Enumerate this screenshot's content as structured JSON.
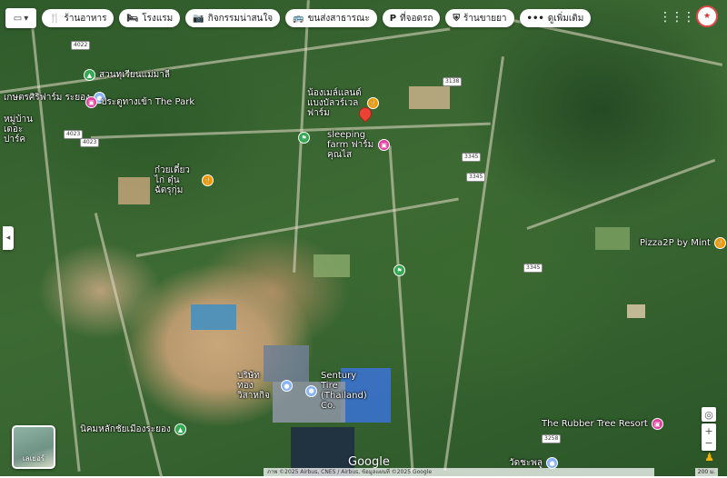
{
  "filters": [
    {
      "icon": "fork-knife-icon",
      "glyph": "🍴",
      "label": "ร้านอาหาร"
    },
    {
      "icon": "bed-icon",
      "glyph": "🛏",
      "label": "โรงแรม"
    },
    {
      "icon": "camera-icon",
      "glyph": "📷",
      "label": "กิจกรรมน่าสนใจ"
    },
    {
      "icon": "bus-icon",
      "glyph": "🚌",
      "label": "ขนส่งสาธารณะ"
    },
    {
      "icon": "parking-icon",
      "glyph": "P",
      "label": "ที่จอดรถ"
    },
    {
      "icon": "pharmacy-icon",
      "glyph": "⛨",
      "label": "ร้านขายยา"
    },
    {
      "icon": "more-icon",
      "glyph": "•••",
      "label": "ดูเพิ่มเติม"
    }
  ],
  "places": [
    {
      "name": "สวนทุเรียนแม่มาลี",
      "color": "#34a853"
    },
    {
      "name": "เกษตรศิริฟาร์ม ระยอง",
      "color": "#8ab4f8"
    },
    {
      "name": "ประตูทางเข้า The Park",
      "color": "#e040a0"
    },
    {
      "name": "หมู่บ้าน เดอะปาร์ค",
      "color": "#8ab4f8"
    },
    {
      "name": "น้องเมล์แลนด์ แบงบัลวร์เวล ฟาร์ม",
      "color": "#f29900"
    },
    {
      "name": "sleeping farm ฟาร์มคุณไส",
      "color": "#e040a0"
    },
    {
      "name": "ก๋วยเตี๋ยวไก่ ตุ๋น ฉัตรุกุ่ม",
      "color": "#f29900"
    },
    {
      "name": "",
      "color": "#34a853"
    },
    {
      "name": "",
      "color": "#34a853"
    },
    {
      "name": "Pizza2P by Mint",
      "color": "#f29900"
    },
    {
      "name": "บริษัท ทอง วิสาหกิจ",
      "color": "#8ab4f8"
    },
    {
      "name": "Sentury Tire (Thailand) Co.",
      "color": "#8ab4f8"
    },
    {
      "name": "นิคมหลักชัยเมืองระยอง",
      "color": "#34a853"
    },
    {
      "name": "The Rubber Tree Resort",
      "color": "#e040a0"
    },
    {
      "name": "วัดชะพลู",
      "color": "#8ab4f8"
    }
  ],
  "road_shields": [
    "4022",
    "4023",
    "4023",
    "3138",
    "3345",
    "3345",
    "3345",
    "3258"
  ],
  "layers_label": "เลเยอร์",
  "google_logo": "Google",
  "attribution": "ภาพ ©2025 Airbus, CNES / Airbus, ข้อมูลแผนที่ ©2025 Google",
  "scale_label": "200 ม."
}
